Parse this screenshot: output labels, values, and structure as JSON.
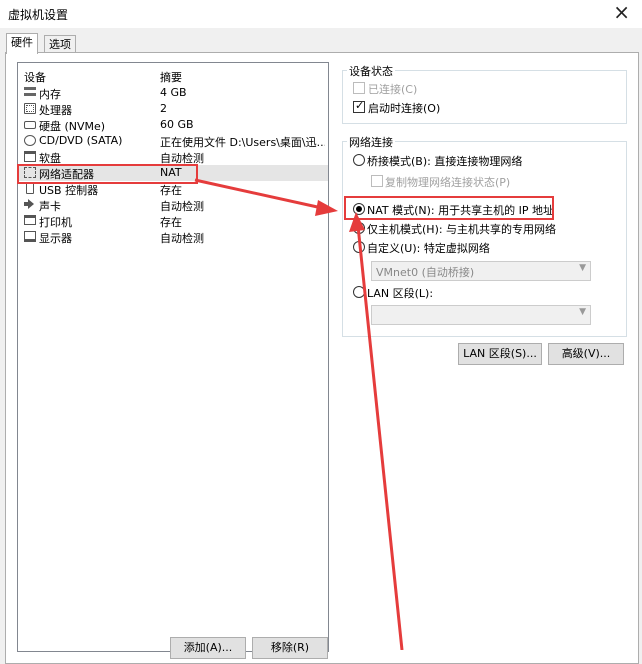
{
  "window": {
    "title": "虚拟机设置",
    "close_glyph": "×"
  },
  "tabs": [
    "硬件",
    "选项"
  ],
  "device_list": {
    "col_device": "设备",
    "col_summary": "摘要",
    "devices": [
      {
        "name": "内存",
        "summary": "4 GB",
        "icon": "memory-icon"
      },
      {
        "name": "处理器",
        "summary": "2",
        "icon": "cpu-icon"
      },
      {
        "name": "硬盘 (NVMe)",
        "summary": "60 GB",
        "icon": "harddisk-icon"
      },
      {
        "name": "CD/DVD (SATA)",
        "summary": "正在使用文件 D:\\Users\\桌面\\迅...",
        "icon": "cd-icon"
      },
      {
        "name": "软盘",
        "summary": "自动检测",
        "icon": "floppy-icon"
      },
      {
        "name": "网络适配器",
        "summary": "NAT",
        "icon": "network-adapter-icon"
      },
      {
        "name": "USB 控制器",
        "summary": "存在",
        "icon": "usb-icon"
      },
      {
        "name": "声卡",
        "summary": "自动检测",
        "icon": "sound-icon"
      },
      {
        "name": "打印机",
        "summary": "存在",
        "icon": "printer-icon"
      },
      {
        "name": "显示器",
        "summary": "自动检测",
        "icon": "monitor-icon"
      }
    ],
    "selected": "网络适配器"
  },
  "buttons": {
    "add": "添加(A)...",
    "remove": "移除(R)",
    "lan_segments": "LAN 区段(S)...",
    "advanced": "高级(V)..."
  },
  "device_status": {
    "title": "设备状态",
    "connected": {
      "label": "已连接(C)",
      "checked": false,
      "enabled": false
    },
    "connect_at_power_on": {
      "label": "启动时连接(O)",
      "checked": true
    }
  },
  "network_connection": {
    "title": "网络连接",
    "bridged": {
      "label": "桥接模式(B): 直接连接物理网络",
      "selected": false
    },
    "replicate": {
      "label": "复制物理网络连接状态(P)",
      "checked": false,
      "enabled": false
    },
    "nat": {
      "label": "NAT 模式(N): 用于共享主机的 IP 地址",
      "selected": true
    },
    "host_only": {
      "label": "仅主机模式(H): 与主机共享的专用网络",
      "selected": false
    },
    "custom": {
      "label": "自定义(U): 特定虚拟网络",
      "selected": false
    },
    "custom_network": "VMnet0 (自动桥接)",
    "lan_segment": {
      "label": "LAN 区段(L):",
      "selected": false
    },
    "lan_segment_value": ""
  },
  "colors": {
    "highlight": "#e53c3c",
    "selection_bg": "#e5e5e5"
  }
}
